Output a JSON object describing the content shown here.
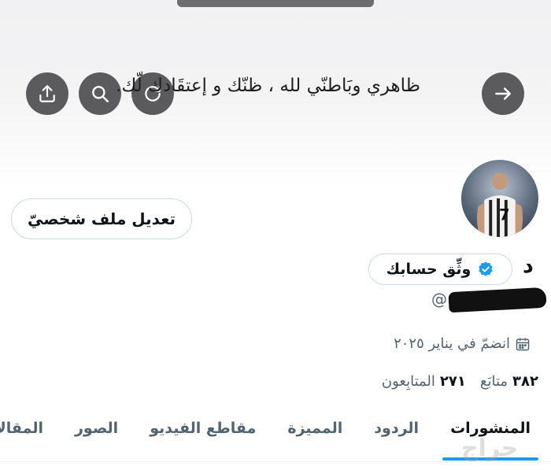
{
  "banner": {
    "text": "ظاهري وبَاطنّي لله ، ظنّك و إعتقَادك لّك."
  },
  "header_buttons": {
    "forward_icon": "arrow-right-icon",
    "refresh_icon": "refresh-icon",
    "search_icon": "search-icon",
    "share_icon": "share-icon"
  },
  "profile": {
    "edit_label": "تعديل ملف شخصيّ",
    "display_name": "د",
    "verify_label": "وثِّق حسابك",
    "handle": "@",
    "joined": "انضمّ في يناير ٢٠٢٥"
  },
  "stats": {
    "following_count": "٣٨٢",
    "following_label": "متابَع",
    "followers_count": "٢٧١",
    "followers_label": "المتابِعون"
  },
  "tabs": [
    "المنشورات",
    "الردود",
    "المميزة",
    "مقاطع الفيديو",
    "الصور",
    "المقالات"
  ],
  "watermark": "حراج",
  "colors": {
    "accent": "#1d9bf0",
    "button_bg": "#5b5b5e",
    "text_secondary": "#536471"
  }
}
